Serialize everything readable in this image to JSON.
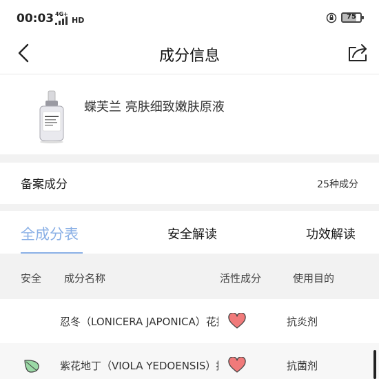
{
  "status_bar": {
    "time": "00:03",
    "network": "4G+",
    "hd": "HD",
    "battery_level": "75",
    "battery_fraction": 0.75
  },
  "nav": {
    "title": "成分信息",
    "back_icon": "chevron-left-icon",
    "share_icon": "share-icon"
  },
  "product": {
    "name": "蝶芙兰 亮肤细致嫩肤原液"
  },
  "filed": {
    "label": "备案成分",
    "count": "25种成分"
  },
  "tabs": [
    {
      "label": "全成分表",
      "active": true
    },
    {
      "label": "安全解读",
      "active": false
    },
    {
      "label": "功效解读",
      "active": false
    }
  ],
  "table": {
    "headers": [
      "安全",
      "成分名称",
      "活性成分",
      "使用目的"
    ],
    "rows": [
      {
        "safety_icon": "",
        "name": "忍冬（LONICERA JAPONICA）花提取物",
        "active_icon": "heart-icon",
        "purpose": "抗炎剂"
      },
      {
        "safety_icon": "leaf-icon",
        "name": "紫花地丁（VIOLA YEDOENSIS）提取物",
        "active_icon": "heart-icon",
        "purpose": "抗菌剂"
      }
    ]
  },
  "colors": {
    "accent": "#8ab0e6",
    "heart_fill": "#f07a7a",
    "leaf_fill": "#9bd9a6"
  }
}
